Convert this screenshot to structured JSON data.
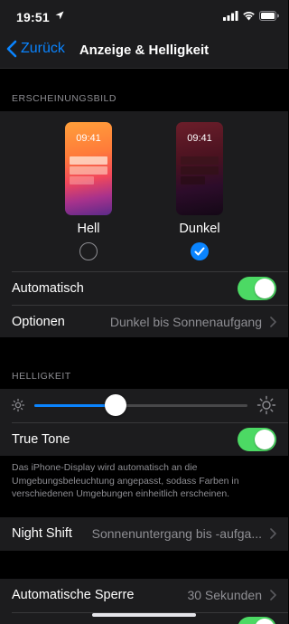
{
  "status_bar": {
    "time": "19:51",
    "icons": [
      "location-arrow-icon",
      "cellular-signal-icon",
      "wifi-icon",
      "battery-icon"
    ]
  },
  "nav": {
    "back_label": "Zurück",
    "title": "Anzeige & Helligkeit"
  },
  "appearance": {
    "header": "ERSCHEINUNGSBILD",
    "options": [
      {
        "label": "Hell",
        "preview_time": "09:41",
        "selected": false
      },
      {
        "label": "Dunkel",
        "preview_time": "09:41",
        "selected": true
      }
    ],
    "automatic": {
      "label": "Automatisch",
      "on": true
    },
    "options_row": {
      "label": "Optionen",
      "value": "Dunkel bis Sonnenaufgang"
    }
  },
  "brightness": {
    "header": "HELLIGKEIT",
    "level": 0.38,
    "true_tone": {
      "label": "True Tone",
      "on": true
    },
    "footnote": "Das iPhone-Display wird automatisch an die Umgebungsbeleuchtung angepasst, sodass Farben in verschiedenen Umgebungen einheitlich erscheinen."
  },
  "night_shift": {
    "label": "Night Shift",
    "value": "Sonnenuntergang bis -aufga..."
  },
  "auto_lock": {
    "label": "Automatische Sperre",
    "value": "30 Sekunden"
  },
  "colors": {
    "accent": "#0a84ff",
    "toggle_on": "#4cd964",
    "background": "#000000",
    "cell": "#1c1c1e",
    "secondary_text": "#8e8e93"
  }
}
